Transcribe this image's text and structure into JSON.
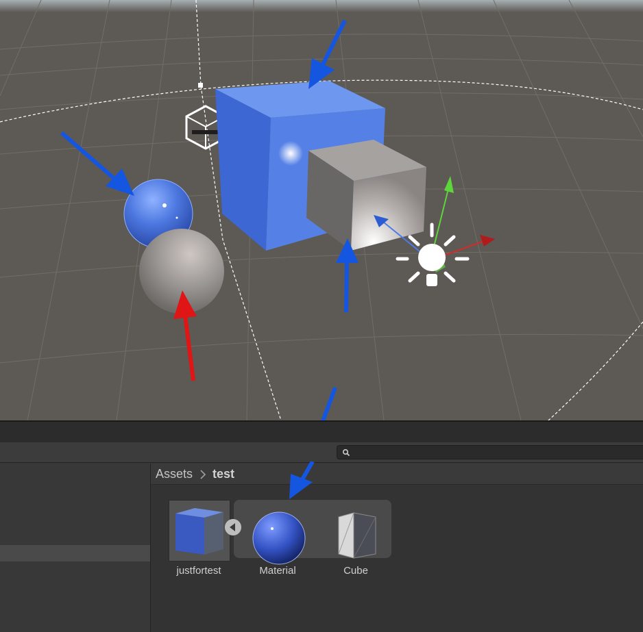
{
  "colors": {
    "ground": "#5d5955",
    "grid": "#7a756f",
    "blue_material": "#4f78d8",
    "gray_material": "#8e8c8a",
    "annotation_blue": "#1556e0",
    "annotation_red": "#e01515",
    "gizmo_x": "#d42a2a",
    "gizmo_y": "#5ed53b",
    "gizmo_z": "#2e5cd1",
    "panel_bg": "#383838"
  },
  "scene": {
    "objects": [
      {
        "name": "blue-cube",
        "material": "blue_material"
      },
      {
        "name": "gray-cube",
        "material": "gray_material"
      },
      {
        "name": "blue-sphere",
        "material": "blue_material"
      },
      {
        "name": "gray-sphere",
        "material": "gray_material"
      },
      {
        "name": "directional-light-gizmo",
        "icon": "sun-icon"
      },
      {
        "name": "camera-gizmo",
        "icon": "camera-box-icon"
      }
    ],
    "annotations": [
      {
        "color": "annotation_blue",
        "target": "blue-cube"
      },
      {
        "color": "annotation_blue",
        "target": "blue-sphere"
      },
      {
        "color": "annotation_blue",
        "target": "gray-cube"
      },
      {
        "color": "annotation_red",
        "target": "gray-sphere"
      },
      {
        "color": "annotation_blue",
        "target": "material-asset"
      }
    ]
  },
  "project": {
    "search": {
      "placeholder": "",
      "value": "",
      "icon": "search-icon"
    },
    "breadcrumb": [
      "Assets",
      "test"
    ],
    "assets": [
      {
        "label": "justfortest",
        "type": "prefab",
        "icon": "cube-icon"
      },
      {
        "label": "Material",
        "type": "material",
        "icon": "sphere-icon"
      },
      {
        "label": "Cube",
        "type": "mesh",
        "icon": "mesh-icon"
      }
    ]
  }
}
